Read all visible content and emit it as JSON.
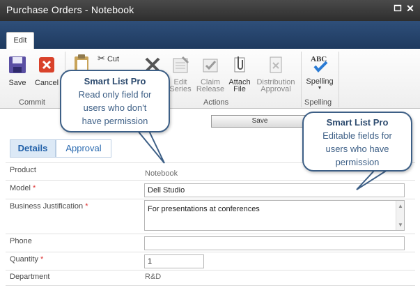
{
  "window": {
    "title": "Purchase Orders - Notebook"
  },
  "ribbon": {
    "tab": "Edit",
    "buttons": {
      "save": "Save",
      "cancel": "Cancel",
      "paste": "Paste",
      "cut": "Cut",
      "delete": "Delete",
      "edit_series_1": "Edit",
      "edit_series_2": "Series",
      "claim_release_1": "Claim",
      "claim_release_2": "Release",
      "attach_file_1": "Attach",
      "attach_file_2": "File",
      "distribution_approval_1": "Distribution",
      "distribution_approval_2": "Approval",
      "spelling": "Spelling"
    },
    "groups": {
      "commit": "Commit",
      "actions": "Actions",
      "spelling": "Spelling"
    }
  },
  "callouts": {
    "left": {
      "head": "Smart List Pro",
      "line1": "Read only field for",
      "line2": "users  who don't",
      "line3": "have permission"
    },
    "right": {
      "head": "Smart List Pro",
      "line1": "Editable fields for",
      "line2": "users who have",
      "line3": "permission"
    }
  },
  "form": {
    "save_label": "Save",
    "tabs": [
      "Details",
      "Approval"
    ],
    "fields": {
      "product": {
        "label": "Product",
        "value": "Notebook"
      },
      "model": {
        "label": "Model",
        "required": "*",
        "value": "Dell Studio"
      },
      "justification": {
        "label": "Business Justification",
        "required": "*",
        "value": "For presentations at conferences"
      },
      "phone": {
        "label": "Phone",
        "value": ""
      },
      "quantity": {
        "label": "Quantity",
        "required": "*",
        "value": "1"
      },
      "department": {
        "label": "Department",
        "value": "R&D"
      }
    }
  },
  "colors": {
    "accent": "#3d5f86",
    "tab_active": "#dce9f6",
    "ribbon_tabstrip": "#1e3a5f"
  }
}
